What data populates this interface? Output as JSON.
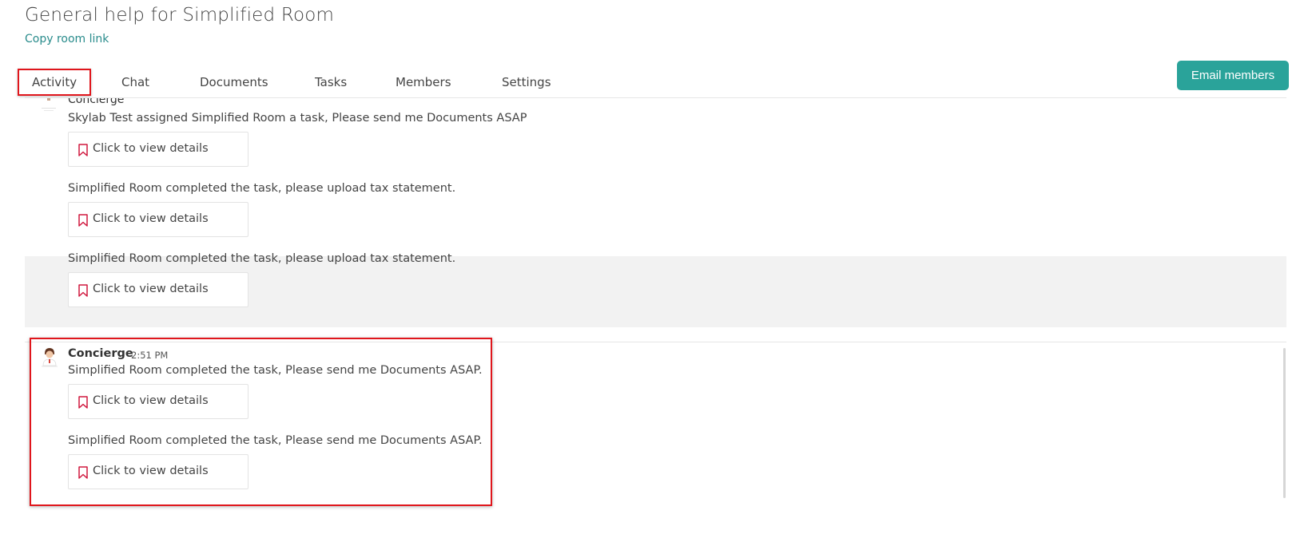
{
  "room": {
    "title": "General help for Simplified Room",
    "copy_link_label": "Copy room link"
  },
  "tabs": [
    {
      "label": "Activity",
      "active": true
    },
    {
      "label": "Chat",
      "active": false
    },
    {
      "label": "Documents",
      "active": false
    },
    {
      "label": "Tasks",
      "active": false
    },
    {
      "label": "Members",
      "active": false
    },
    {
      "label": "Settings",
      "active": false
    }
  ],
  "email_members_label": "Email members",
  "colors": {
    "accent": "#2aa39a",
    "link": "#2a8c8c",
    "highlight_red": "#e0161c",
    "bookmark": "#d0193f"
  },
  "feed": {
    "top_group": {
      "author_partial": "Concierge",
      "items": [
        {
          "message": "Skylab Test assigned Simplified Room a task, Please send me Documents ASAP",
          "details_label": "Click to view details"
        },
        {
          "message": "Simplified Room completed the task, please upload tax statement.",
          "details_label": "Click to view details"
        },
        {
          "message": "Simplified Room completed the task, please upload tax statement.",
          "details_label": "Click to view details",
          "highlighted": true
        }
      ]
    },
    "selected_group": {
      "author": "Concierge",
      "time": "2:51 PM",
      "items": [
        {
          "message": "Simplified Room completed the task, Please send me Documents ASAP.",
          "details_label": "Click to view details"
        },
        {
          "message": "Simplified Room completed the task, Please send me Documents ASAP.",
          "details_label": "Click to view details"
        }
      ]
    }
  },
  "icons": {
    "bookmark": "bookmark-icon",
    "avatar": "concierge-avatar-icon"
  }
}
